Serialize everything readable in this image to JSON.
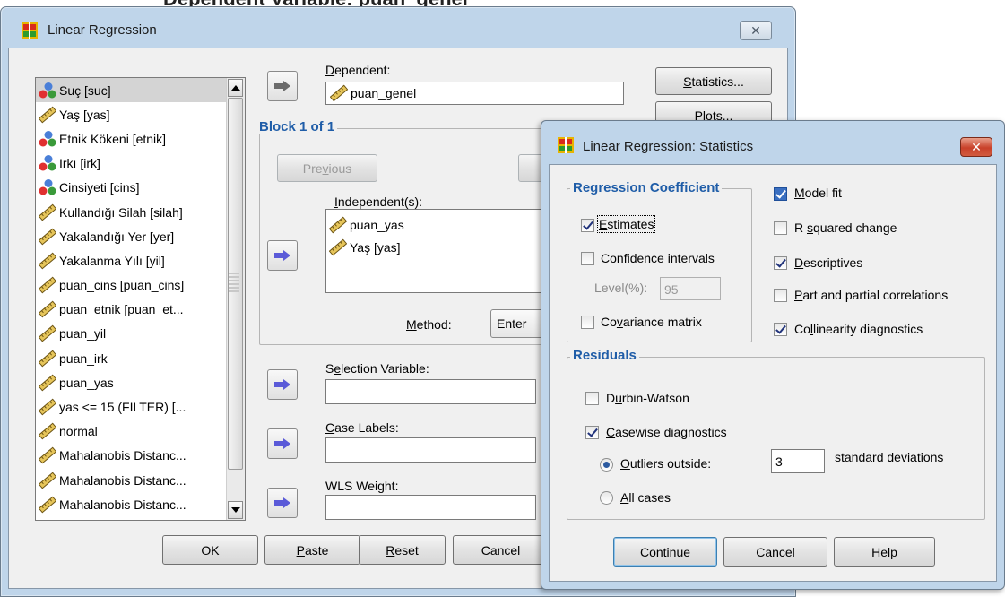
{
  "background": {
    "text": "Dependent Variable: puan_genel"
  },
  "main": {
    "title": "Linear Regression",
    "close_label": "✕",
    "variables": [
      {
        "label": "Suç [suc]",
        "icon": "nominal-icon",
        "selected": true
      },
      {
        "label": "Yaş [yas]",
        "icon": "scale-icon"
      },
      {
        "label": "Etnik Kökeni [etnik]",
        "icon": "nominal-icon"
      },
      {
        "label": "Irkı [irk]",
        "icon": "nominal-icon"
      },
      {
        "label": "Cinsiyeti [cins]",
        "icon": "nominal-icon"
      },
      {
        "label": "Kullandığı Silah [silah]",
        "icon": "scale-icon"
      },
      {
        "label": "Yakalandığı Yer [yer]",
        "icon": "scale-icon"
      },
      {
        "label": "Yakalanma Yılı [yil]",
        "icon": "scale-icon"
      },
      {
        "label": "puan_cins [puan_cins]",
        "icon": "scale-icon"
      },
      {
        "label": "puan_etnik [puan_et...",
        "icon": "scale-icon"
      },
      {
        "label": "puan_yil",
        "icon": "scale-icon"
      },
      {
        "label": "puan_irk",
        "icon": "scale-icon"
      },
      {
        "label": "puan_yas",
        "icon": "scale-icon"
      },
      {
        "label": "yas <= 15 (FILTER) [...",
        "icon": "scale-icon"
      },
      {
        "label": "normal",
        "icon": "scale-icon"
      },
      {
        "label": "Mahalanobis Distanc...",
        "icon": "scale-icon"
      },
      {
        "label": "Mahalanobis Distanc...",
        "icon": "scale-icon"
      },
      {
        "label": "Mahalanobis Distanc...",
        "icon": "scale-icon"
      }
    ],
    "dependent": {
      "label_pre": "",
      "label_u": "D",
      "label_post": "ependent:",
      "value": "puan_genel"
    },
    "block": {
      "label": "Block 1 of 1",
      "previous_pre": "Pre",
      "previous_u": "v",
      "previous_post": "ious"
    },
    "independents": {
      "label_pre": "",
      "label_u": "I",
      "label_post": "ndependent(s):",
      "items": [
        "puan_yas",
        "Yaş [yas]"
      ]
    },
    "method": {
      "label_pre": "",
      "label_u": "M",
      "label_post": "ethod:",
      "value": "Enter"
    },
    "selection": {
      "label_pre": "S",
      "label_u": "e",
      "label_post": "lection Variable:"
    },
    "case_labels": {
      "label_pre": "",
      "label_u": "C",
      "label_post": "ase Labels:"
    },
    "wls": {
      "label_pre": "WLS Wei",
      "label_u": "g",
      "label_post": "ht:"
    },
    "side_buttons": {
      "statistics_pre": "",
      "statistics_u": "S",
      "statistics_post": "tatistics...",
      "plots": "Plots..."
    },
    "footer": {
      "ok": "OK",
      "paste_pre": "",
      "paste_u": "P",
      "paste_post": "aste",
      "reset_pre": "",
      "reset_u": "R",
      "reset_post": "eset",
      "cancel": "Cancel"
    }
  },
  "stats": {
    "title": "Linear Regression: Statistics",
    "close_label": "✕",
    "regression": {
      "label": "Regression Coefficient",
      "estimates": {
        "pre": "",
        "u": "E",
        "post": "stimates",
        "checked": true
      },
      "confidence": {
        "pre": "Co",
        "u": "n",
        "post": "fidence intervals",
        "checked": false
      },
      "level_label": "Level(%):",
      "level_value": "95",
      "covariance": {
        "pre": "Co",
        "u": "v",
        "post": "ariance matrix",
        "checked": false
      }
    },
    "options": {
      "model_fit": {
        "pre": "",
        "u": "M",
        "post": "odel fit",
        "checked": true
      },
      "r_squared": {
        "pre": "R ",
        "u": "s",
        "post": "quared change",
        "checked": false
      },
      "descriptives": {
        "pre": "",
        "u": "D",
        "post": "escriptives",
        "checked": true
      },
      "part_partial": {
        "pre": "",
        "u": "P",
        "post": "art and partial correlations",
        "checked": false
      },
      "collinearity": {
        "pre": "Co",
        "u": "l",
        "post": "linearity diagnostics",
        "checked": true
      }
    },
    "residuals": {
      "label": "Residuals",
      "durbin": {
        "pre": "D",
        "u": "u",
        "post": "rbin-Watson",
        "checked": false
      },
      "casewise": {
        "pre": "",
        "u": "C",
        "post": "asewise diagnostics",
        "checked": true
      },
      "outliers": {
        "pre": "",
        "u": "O",
        "post": "utliers outside:",
        "selected": true
      },
      "outliers_value": "3",
      "std_label": "standard deviations",
      "all_cases": {
        "pre": "",
        "u": "A",
        "post": "ll cases",
        "selected": false
      }
    },
    "footer": {
      "continue": "Continue",
      "cancel": "Cancel",
      "help": "Help"
    }
  }
}
